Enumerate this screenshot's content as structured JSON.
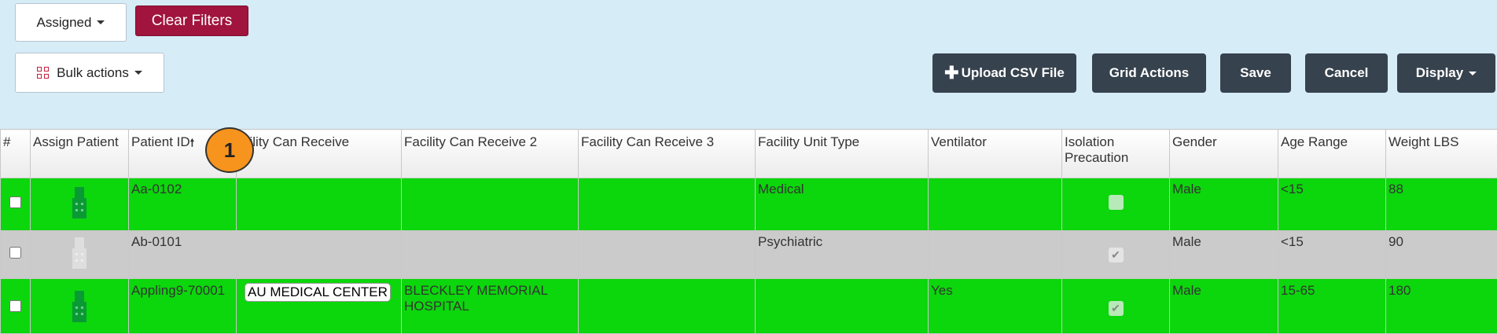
{
  "toolbar": {
    "assigned_label": "Assigned",
    "clear_filters_label": "Clear Filters",
    "bulk_actions_label": "Bulk actions",
    "upload_csv_label": "Upload CSV File",
    "grid_actions_label": "Grid Actions",
    "save_label": "Save",
    "cancel_label": "Cancel",
    "display_label": "Display"
  },
  "badge": "1",
  "columns": [
    "#",
    "Assign Patient",
    "Patient ID",
    "cility Can Receive",
    "Facility Can Receive 2",
    "Facility Can Receive 3",
    "Facility Unit Type",
    "Ventilator",
    "Isolation Precaution",
    "Gender",
    "Age Range",
    "Weight LBS"
  ],
  "rows": [
    {
      "patient_id": "Aa-0102",
      "can_receive": "",
      "can_receive_2": "",
      "can_receive_3": "",
      "unit_type": "Medical",
      "ventilator": "",
      "gender": "Male",
      "age_range": "<15",
      "weight": "88"
    },
    {
      "patient_id": "Ab-0101",
      "can_receive": "",
      "can_receive_2": "",
      "can_receive_3": "",
      "unit_type": "Psychiatric",
      "ventilator": "",
      "gender": "Male",
      "age_range": "<15",
      "weight": "90"
    },
    {
      "patient_id": "Appling9-70001",
      "can_receive": "AU MEDICAL CENTER",
      "can_receive_2": "BLECKLEY MEMORIAL HOSPITAL",
      "can_receive_3": "",
      "unit_type": "",
      "ventilator": "Yes",
      "gender": "Male",
      "age_range": "15-65",
      "weight": "180"
    }
  ],
  "colors": {
    "row_green": "#0cd60c",
    "row_gray": "#cbcbcb",
    "clear_filters": "#a0143d",
    "dark_button": "#36424d",
    "badge": "#f7941d"
  }
}
